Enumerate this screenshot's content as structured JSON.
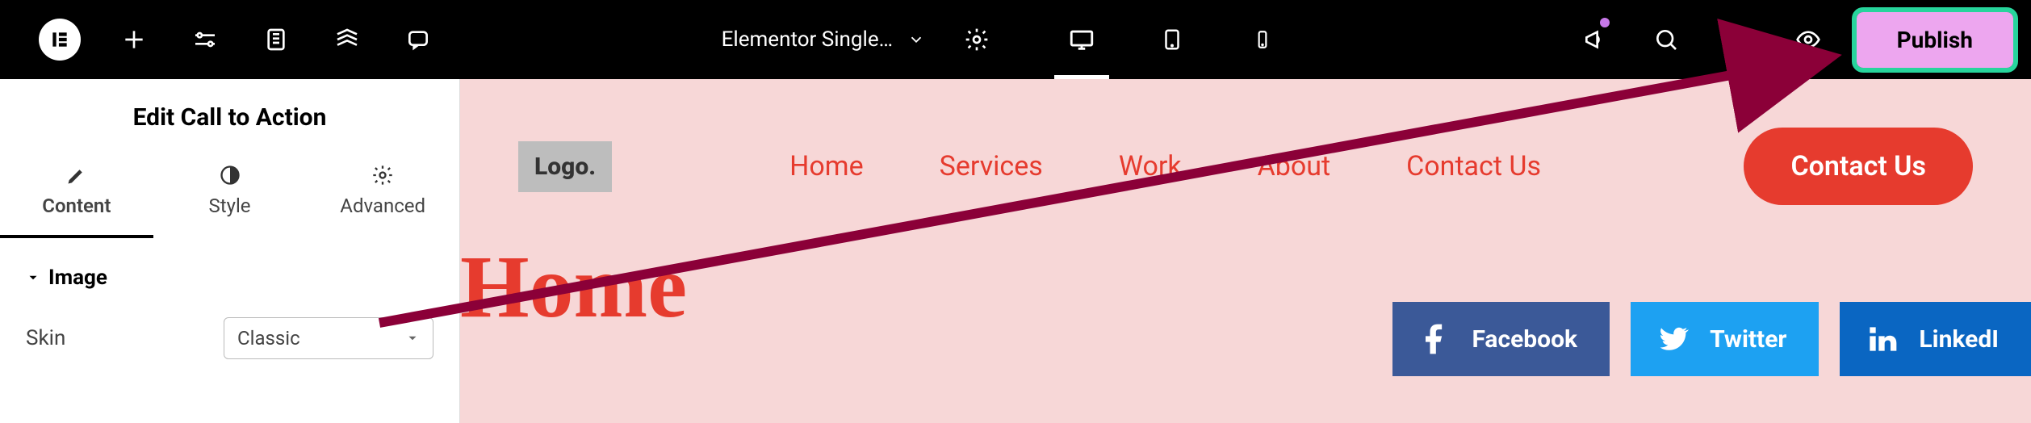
{
  "topbar": {
    "document_name": "Elementor Single…",
    "publish_label": "Publish"
  },
  "sidebar": {
    "panel_title": "Edit Call to Action",
    "tabs": {
      "content": "Content",
      "style": "Style",
      "advanced": "Advanced"
    },
    "section_image": "Image",
    "field_skin_label": "Skin",
    "field_skin_value": "Classic"
  },
  "canvas": {
    "logo_placeholder": "Logo.",
    "nav": {
      "home": "Home",
      "services": "Services",
      "work": "Work",
      "about": "About",
      "contact": "Contact Us"
    },
    "cta": "Contact Us",
    "page_title": "Home",
    "socials": {
      "facebook": "Facebook",
      "twitter": "Twitter",
      "linkedin": "LinkedI"
    }
  }
}
